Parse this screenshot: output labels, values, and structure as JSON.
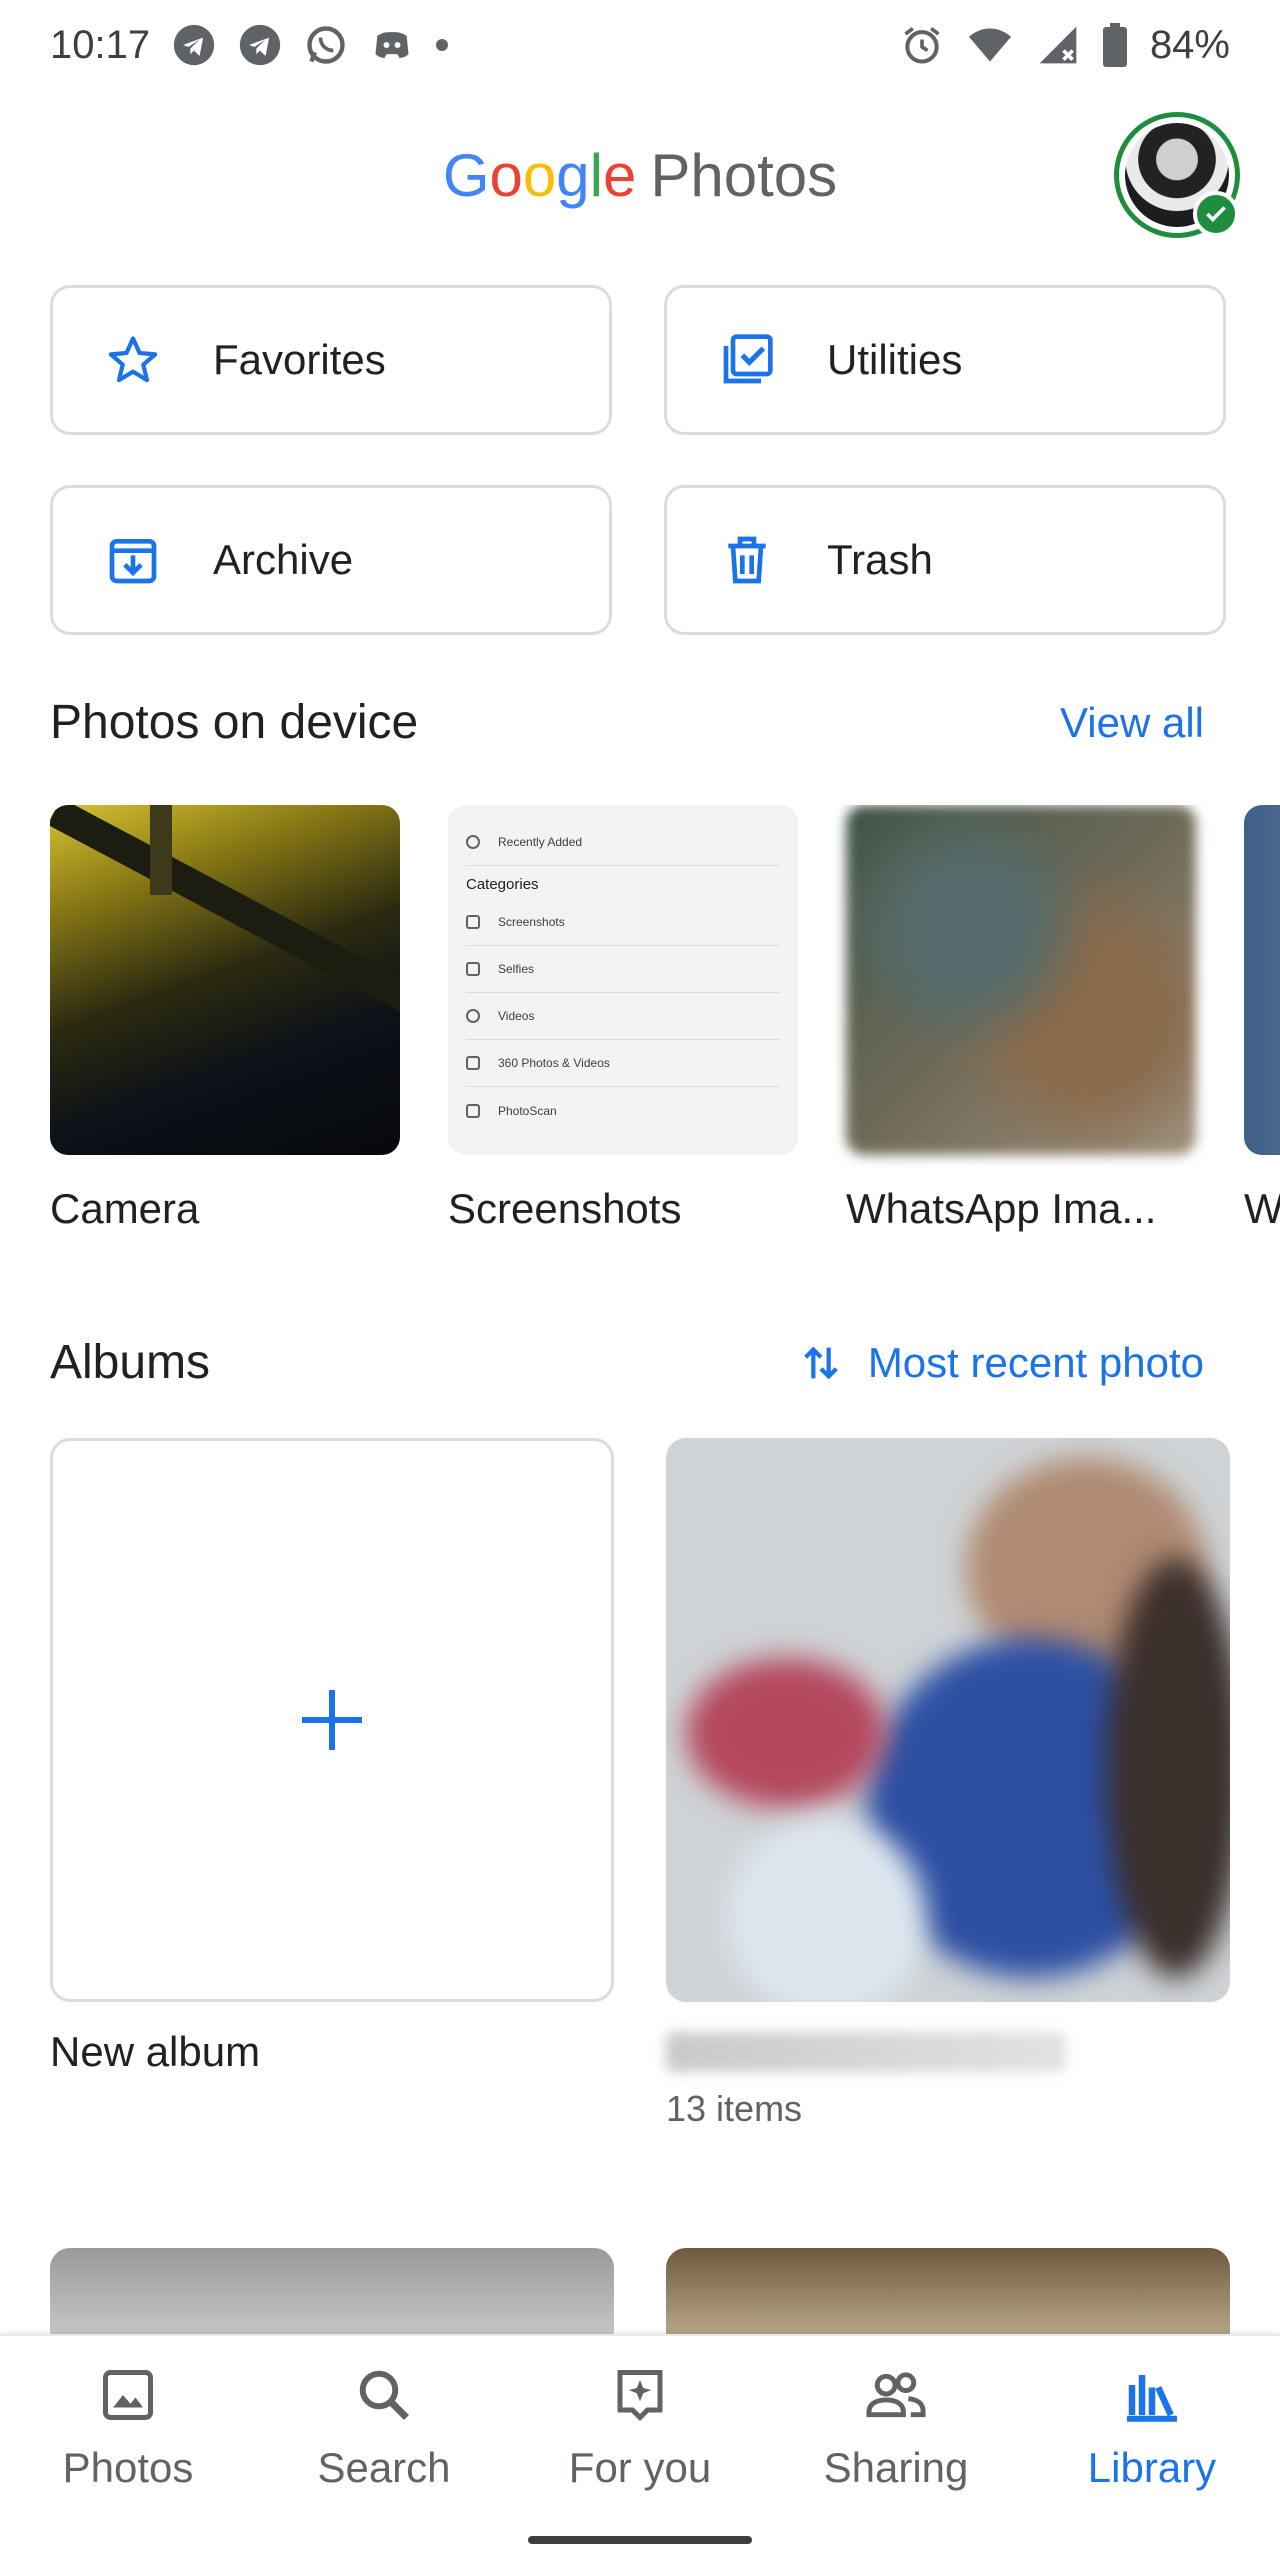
{
  "status_bar": {
    "time": "10:17",
    "battery": "84%",
    "icons": [
      "telegram-icon",
      "telegram-icon",
      "whatsapp-icon",
      "discord-icon",
      "dot-icon",
      "alarm-icon",
      "wifi-icon",
      "signal-icon",
      "battery-icon"
    ]
  },
  "header": {
    "brand_google_letters": [
      "G",
      "o",
      "o",
      "g",
      "l",
      "e"
    ],
    "brand_google_colors": [
      "#4285F4",
      "#EA4335",
      "#FBBC05",
      "#4285F4",
      "#34A853",
      "#EA4335"
    ],
    "brand_photos": "Photos"
  },
  "quick": {
    "favorites": "Favorites",
    "utilities": "Utilities",
    "archive": "Archive",
    "trash": "Trash"
  },
  "device": {
    "title": "Photos on device",
    "view_all": "View all",
    "folders": [
      "Camera",
      "Screenshots",
      "WhatsApp Ima...",
      "W"
    ]
  },
  "screenshot_thumb": {
    "recently_added": "Recently Added",
    "categories": "Categories",
    "items": [
      "Screenshots",
      "Selfies",
      "Videos",
      "360 Photos & Videos",
      "PhotoScan"
    ]
  },
  "albums": {
    "title": "Albums",
    "sort_label": "Most recent photo",
    "new_album": "New album",
    "album_count": "13 items"
  },
  "nav": {
    "photos": "Photos",
    "search": "Search",
    "for_you": "For you",
    "sharing": "Sharing",
    "library": "Library",
    "active": "Library"
  },
  "colors": {
    "accent": "#1a73e8",
    "text": "#202124",
    "muted": "#5f6368",
    "border": "#dadce0",
    "avatar_ring": "#1e8e3e"
  }
}
